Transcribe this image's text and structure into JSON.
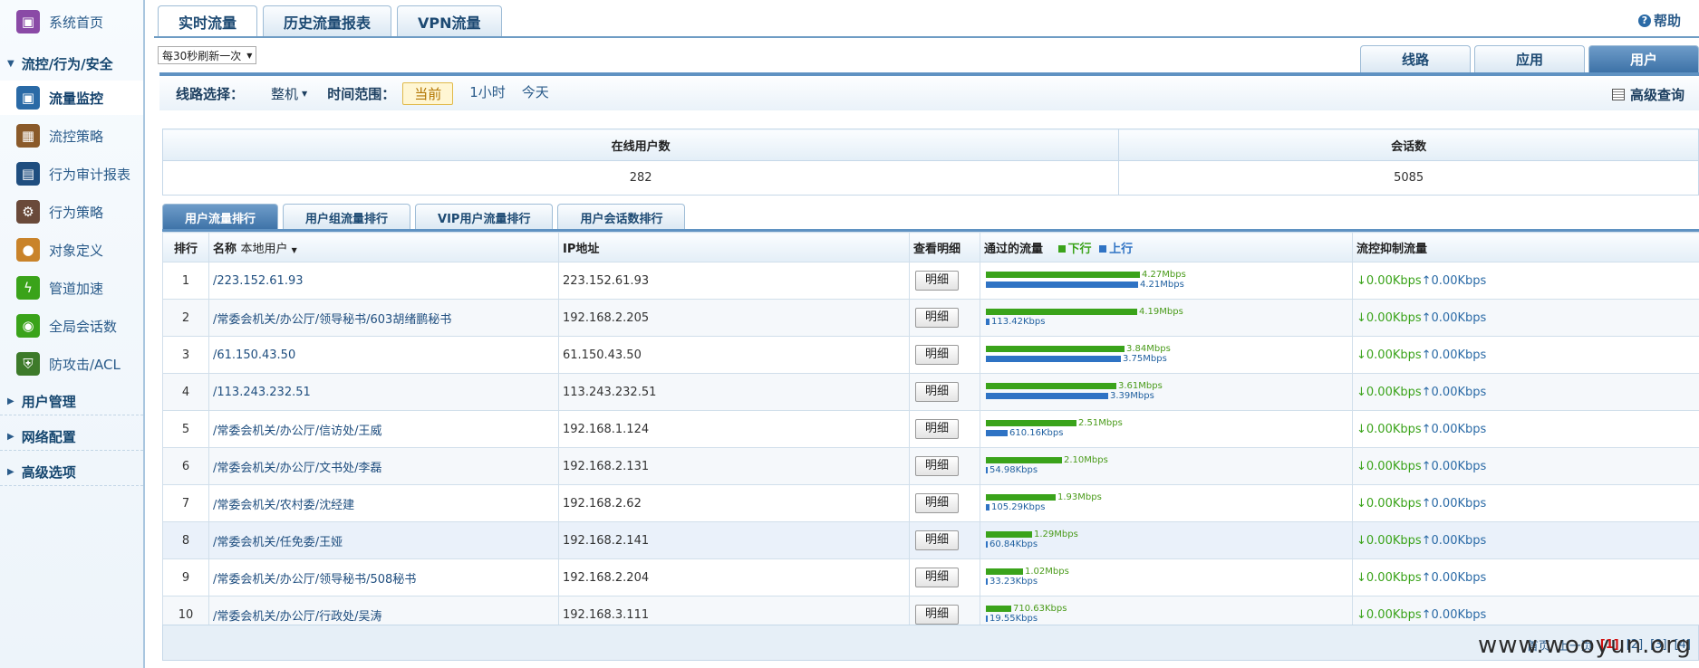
{
  "sidebar": {
    "home": "系统首页",
    "group_flow": "流控/行为/安全",
    "items": [
      {
        "label": "流量监控",
        "icon": "monitor-icon",
        "color": "#2a6aa6"
      },
      {
        "label": "流控策略",
        "icon": "policy-icon",
        "color": "#8a5a2a"
      },
      {
        "label": "行为审计报表",
        "icon": "book-icon",
        "color": "#1f4e7f"
      },
      {
        "label": "行为策略",
        "icon": "gear-icon",
        "color": "#6a4a3a"
      },
      {
        "label": "对象定义",
        "icon": "palette-icon",
        "color": "#c9832a"
      },
      {
        "label": "管道加速",
        "icon": "lightning-icon",
        "color": "#3aa31a"
      },
      {
        "label": "全局会话数",
        "icon": "chat-icon",
        "color": "#3aa31a"
      },
      {
        "label": "防攻击/ACL",
        "icon": "shield-icon",
        "color": "#3d7a2a"
      }
    ],
    "groups": [
      "用户管理",
      "网络配置",
      "高级选项"
    ]
  },
  "top_tabs": [
    "实时流量",
    "历史流量报表",
    "VPN流量"
  ],
  "help": "帮助",
  "refresh": "每30秒刷新一次",
  "view_tabs": [
    "线路",
    "应用",
    "用户"
  ],
  "filter": {
    "line_label": "线路选择：",
    "line_value": "整机",
    "range_label": "时间范围：",
    "ranges": [
      "当前",
      "1小时",
      "今天"
    ]
  },
  "advanced": "高级查询",
  "stats": {
    "online_label": "在线用户数",
    "online_value": "282",
    "sessions_label": "会话数",
    "sessions_value": "5085"
  },
  "rank_tabs": [
    "用户流量排行",
    "用户组流量排行",
    "VIP用户流量排行",
    "用户会话数排行"
  ],
  "columns": {
    "rank": "排行",
    "name": "名称",
    "name_filter": "本地用户",
    "ip": "IP地址",
    "detail": "查看明细",
    "flow": "通过的流量",
    "down": "下行",
    "up": "上行",
    "ctrl": "流控抑制流量"
  },
  "detail_label": "明细",
  "rows": [
    {
      "rank": "1",
      "name": "/223.152.61.93",
      "ip": "223.152.61.93",
      "down": "4.27Mbps",
      "up": "4.21Mbps",
      "down_frac": 1.0,
      "up_frac": 0.986,
      "ctrl_down": "↓0.00Kbps",
      "ctrl_up": "↑0.00Kbps"
    },
    {
      "rank": "2",
      "name": "/常委会机关/办公厅/领导秘书/603胡绪鹏秘书",
      "ip": "192.168.2.205",
      "down": "4.19Mbps",
      "up": "113.42Kbps",
      "down_frac": 0.981,
      "up_frac": 0.026,
      "ctrl_down": "↓0.00Kbps",
      "ctrl_up": "↑0.00Kbps"
    },
    {
      "rank": "3",
      "name": "/61.150.43.50",
      "ip": "61.150.43.50",
      "down": "3.84Mbps",
      "up": "3.75Mbps",
      "down_frac": 0.899,
      "up_frac": 0.878,
      "ctrl_down": "↓0.00Kbps",
      "ctrl_up": "↑0.00Kbps"
    },
    {
      "rank": "4",
      "name": "/113.243.232.51",
      "ip": "113.243.232.51",
      "down": "3.61Mbps",
      "up": "3.39Mbps",
      "down_frac": 0.845,
      "up_frac": 0.794,
      "ctrl_down": "↓0.00Kbps",
      "ctrl_up": "↑0.00Kbps"
    },
    {
      "rank": "5",
      "name": "/常委会机关/办公厅/信访处/王威",
      "ip": "192.168.1.124",
      "down": "2.51Mbps",
      "up": "610.16Kbps",
      "down_frac": 0.588,
      "up_frac": 0.14,
      "ctrl_down": "↓0.00Kbps",
      "ctrl_up": "↑0.00Kbps"
    },
    {
      "rank": "6",
      "name": "/常委会机关/办公厅/文书处/李磊",
      "ip": "192.168.2.131",
      "down": "2.10Mbps",
      "up": "54.98Kbps",
      "down_frac": 0.492,
      "up_frac": 0.013,
      "ctrl_down": "↓0.00Kbps",
      "ctrl_up": "↑0.00Kbps"
    },
    {
      "rank": "7",
      "name": "/常委会机关/农村委/沈经建",
      "ip": "192.168.2.62",
      "down": "1.93Mbps",
      "up": "105.29Kbps",
      "down_frac": 0.452,
      "up_frac": 0.024,
      "ctrl_down": "↓0.00Kbps",
      "ctrl_up": "↑0.00Kbps"
    },
    {
      "rank": "8",
      "name": "/常委会机关/任免委/王娅",
      "ip": "192.168.2.141",
      "down": "1.29Mbps",
      "up": "60.84Kbps",
      "down_frac": 0.302,
      "up_frac": 0.014,
      "ctrl_down": "↓0.00Kbps",
      "ctrl_up": "↑0.00Kbps"
    },
    {
      "rank": "9",
      "name": "/常委会机关/办公厅/领导秘书/508秘书",
      "ip": "192.168.2.204",
      "down": "1.02Mbps",
      "up": "33.23Kbps",
      "down_frac": 0.239,
      "up_frac": 0.008,
      "ctrl_down": "↓0.00Kbps",
      "ctrl_up": "↑0.00Kbps"
    },
    {
      "rank": "10",
      "name": "/常委会机关/办公厅/行政处/吴涛",
      "ip": "192.168.3.111",
      "down": "710.63Kbps",
      "up": "19.55Kbps",
      "down_frac": 0.163,
      "up_frac": 0.005,
      "ctrl_down": "↓0.00Kbps",
      "ctrl_up": "↑0.00Kbps"
    }
  ],
  "pager": {
    "first": "首页",
    "prev": "上一页",
    "pages": [
      "[1]",
      "[2]",
      "[3]",
      "[4]"
    ]
  },
  "watermark": "www.wooyun.org",
  "colors": {
    "down": "#3aa31a",
    "up": "#2f73c4",
    "accent": "#3d72a7"
  }
}
